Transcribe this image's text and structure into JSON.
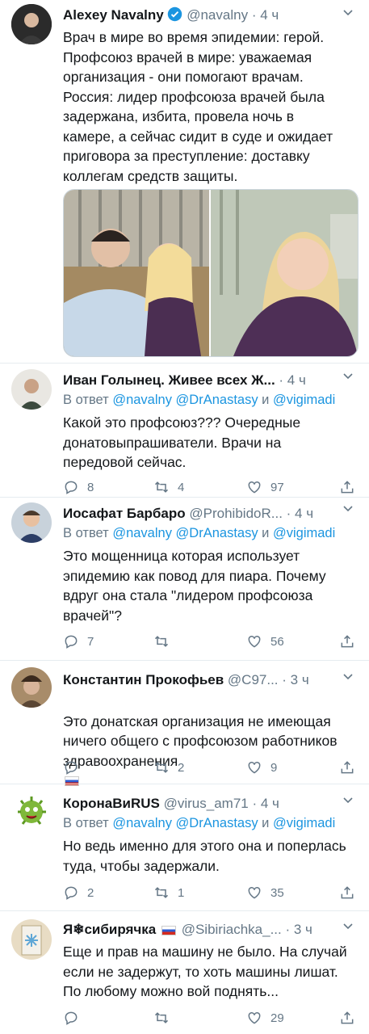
{
  "tweets": [
    {
      "name": "Alexey Navalny",
      "handle": "@navalny",
      "time": "· 4 ч",
      "verified": true,
      "text": "Врач в мире во время эпидемии: герой.\nПрофсоюз врачей в мире: уважаемая\nорганизация - они помогают врачам.\nРоссия: лидер профсоюза врачей была\nзадержана, избита, провела ночь в\nкамере, а сейчас сидит в суде и ожидает\nприговора за преступление: доставку\nколлегам средств защиты."
    },
    {
      "name": "Иван Голынец. Живее всех Ж...",
      "handle": "",
      "time": "· 4 ч",
      "reply_prefix": "В ответ",
      "reply_mentions": [
        "@navalny",
        "@DrAnastasy",
        "@vigimadi"
      ],
      "reply_and": "и",
      "text": "Какой это профсоюз??? Очередные\nдонатовыпрашиватели. Врачи на\nпередовой сейчас.",
      "replies": "8",
      "retweets": "4",
      "likes": "97"
    },
    {
      "name": "Иосафат Барбаро",
      "handle": "@ProhibidoR...",
      "time": "· 4 ч",
      "reply_prefix": "В ответ",
      "reply_mentions": [
        "@navalny",
        "@DrAnastasy",
        "@vigimadi"
      ],
      "reply_and": "и",
      "text": "Это мощенница которая использует\nэпидемию как повод для пиара. Почему\nвдруг она стала \"лидером профсоюза\nврачей\"?",
      "replies": "7",
      "retweets": "",
      "likes": "56"
    },
    {
      "name": "Константин Прокофьев",
      "handle": "@C97...",
      "time": "· 3 ч",
      "text": "Это донатская организация не имеющая\nничего общего с профсоюзом работников\nздравоохранения",
      "replies": "",
      "retweets": "2",
      "likes": "9"
    },
    {
      "name": "КоронаВиRUS",
      "handle": "@virus_am71",
      "time": "· 4 ч",
      "reply_prefix": "В ответ",
      "reply_mentions": [
        "@navalny",
        "@DrAnastasy",
        "@vigimadi"
      ],
      "reply_and": "и",
      "text": "Но ведь именно для этого она и поперлась\nтуда, чтобы задержали.",
      "replies": "2",
      "retweets": "1",
      "likes": "35"
    },
    {
      "name": "Я❄сибирячка",
      "handle": "@Sibiriachka_...",
      "time": "· 3 ч",
      "text": "Еще и прав на машину не было. На случай\nесли не задержут, то хоть машины лишат.\nПо любому можно вой поднять...",
      "replies": "",
      "retweets": "",
      "likes": "29"
    }
  ],
  "colors": {
    "accent": "#1b95e0",
    "muted": "#657786",
    "text": "#14171a",
    "separator": "#e6ecf0"
  },
  "icons": [
    "chevron-down-icon",
    "verified-badge-icon",
    "reply-icon",
    "retweet-icon",
    "like-icon",
    "share-icon"
  ]
}
